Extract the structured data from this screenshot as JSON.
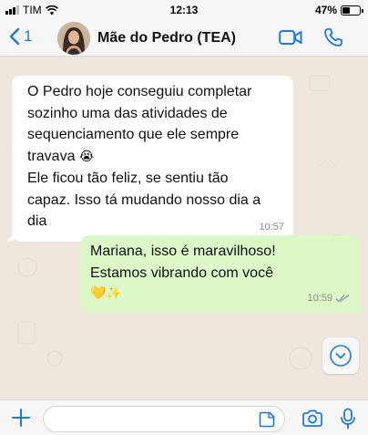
{
  "status_bar": {
    "carrier": "TIM",
    "time": "12:13",
    "battery": "47%",
    "battery_level": 0.47
  },
  "header": {
    "back_count": "1",
    "contact_name": "Mãe do Pedro (TEA)"
  },
  "messages": [
    {
      "direction": "incoming",
      "lines": [
        "O Pedro hoje conseguiu completar",
        "sozinho uma das atividades de",
        "sequenciamento que ele sempre",
        "travava"
      ],
      "emoji": "😭",
      "lines2": [
        "Ele ficou tão feliz, se sentiu tão",
        "capaz. Isso tá mudando nosso dia a",
        "dia"
      ],
      "time": "10:57"
    },
    {
      "direction": "outgoing",
      "lines": [
        "Mariana, isso é maravilhoso!",
        "Estamos vibrando com você"
      ],
      "emoji": "💛✨",
      "time": "10:59",
      "status": "read"
    }
  ],
  "composer": {
    "value": "",
    "placeholder": ""
  },
  "colors": {
    "accent": "#1f78e0",
    "incoming_bubble": "#ffffff",
    "outgoing_bubble": "#dcf8c6",
    "chat_background": "#efe7de",
    "read_ticks": "#8fa0ad"
  },
  "icons": {
    "back": "chevron-left-icon",
    "video": "video-camera-icon",
    "phone": "phone-icon",
    "scroll_down": "chevron-down-circle-icon",
    "attach": "plus-icon",
    "sticker": "sticker-icon",
    "camera": "camera-icon",
    "mic": "microphone-icon"
  }
}
